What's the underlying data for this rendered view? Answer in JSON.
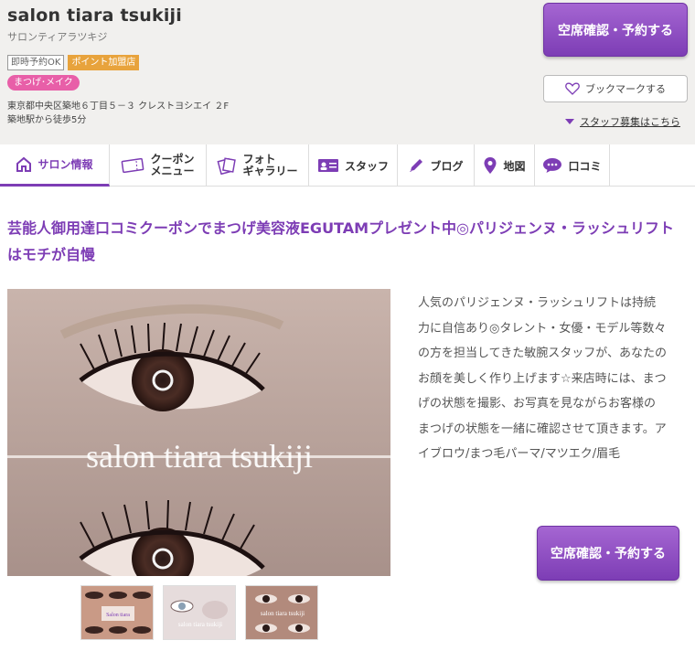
{
  "header": {
    "salon_name": "salon tiara tsukiji",
    "salon_kana": "サロンティアラツキジ",
    "badges": [
      "即時予約OK",
      "ポイント加盟店"
    ],
    "genre_tag": "まつげ･メイク",
    "address_line1": "東京都中央区築地６丁目５－３ クレストヨシエイ ２F",
    "address_line2": "築地駅から徒歩5分",
    "reserve_button": "空席確認・予約する",
    "bookmark_button": "ブックマークする",
    "staff_recruit_link": "スタッフ募集はこちら"
  },
  "nav": {
    "items": [
      {
        "label": "サロン情報",
        "icon": "home-icon"
      },
      {
        "label_line1": "クーポン",
        "label_line2": "メニュー",
        "icon": "coupon-icon"
      },
      {
        "label_line1": "フォト",
        "label_line2": "ギャラリー",
        "icon": "photo-icon"
      },
      {
        "label": "スタッフ",
        "icon": "staff-card-icon"
      },
      {
        "label": "ブログ",
        "icon": "pencil-icon"
      },
      {
        "label": "地図",
        "icon": "map-pin-icon"
      },
      {
        "label": "口コミ",
        "icon": "speech-bubble-icon"
      }
    ]
  },
  "main": {
    "catch_copy": "芸能人御用達口コミクーポンでまつげ美容液EGUTAMプレゼント中◎パリジェンヌ・ラッシュリフトはモチが自慢",
    "photo_watermark": "salon tiara tsukiji",
    "description": "人気のパリジェンヌ・ラッシュリフトは持続力に自信あり◎タレント・女優・モデル等数々の方を担当してきた敏腕スタッフが、あなたのお顔を美しく作り上げます☆来店時には、まつげの状態を撮影、お写真を見ながらお客様のまつげの状態を一緒に確認させて頂きます。アイブロウ/まつ毛パーマ/マツエク/眉毛",
    "reserve_button": "空席確認・予約する",
    "thumbnails": [
      {
        "caption": "Salon tiara"
      },
      {
        "caption": "salon tiara tsukiji"
      },
      {
        "caption": "salon tiara tsukiji"
      }
    ]
  },
  "colors": {
    "accent_purple": "#7d3db5",
    "badge_orange": "#e8a33c",
    "tag_pink": "#e85fa8",
    "header_bg": "#f1f0ee"
  }
}
